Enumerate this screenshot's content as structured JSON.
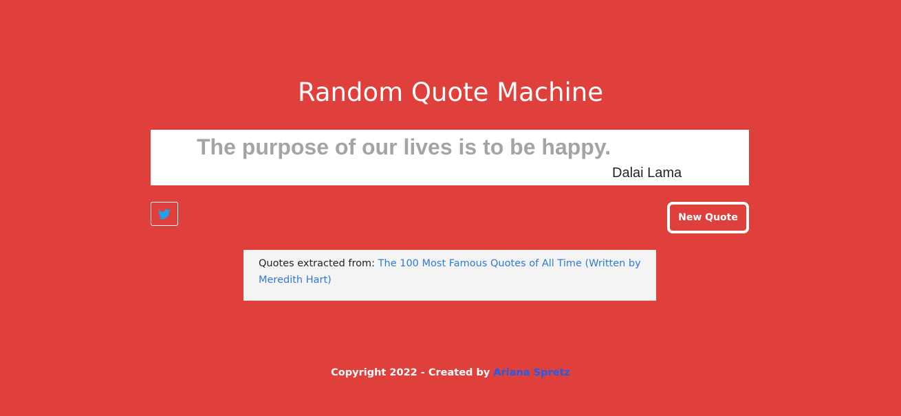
{
  "page": {
    "title": "Random Quote Machine",
    "background_color": "#e0403c"
  },
  "quote": {
    "text": "The purpose of our lives is to be happy.",
    "author": "Dalai Lama"
  },
  "actions": {
    "tweet_icon": "twitter-icon",
    "twitter_color": "#1da1f2",
    "new_quote_label": "New Quote"
  },
  "source": {
    "prefix": "Quotes extracted from: ",
    "link_text": "The 100 Most Famous Quotes of All Time (Written by Meredith Hart)"
  },
  "footer": {
    "text": "Copyright 2022 - Created by ",
    "author_link": "Ariana Spretz"
  }
}
